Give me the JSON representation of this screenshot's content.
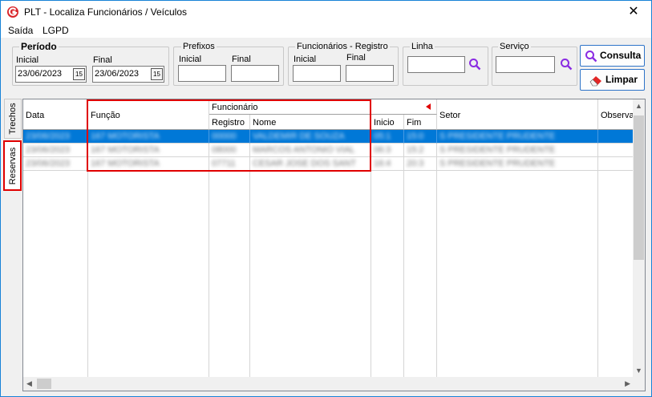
{
  "window": {
    "title": "PLT - Localiza Funcionários / Veículos",
    "close_glyph": "✕"
  },
  "menu": [
    "Saída",
    "LGPD"
  ],
  "periodo": {
    "title": "Período",
    "inicial_label": "Inicial",
    "inicial_value": "23/06/2023",
    "final_label": "Final",
    "final_value": "23/06/2023",
    "cal_glyph": "15"
  },
  "prefixos": {
    "title": "Prefixos",
    "inicial_label": "Inicial",
    "final_label": "Final"
  },
  "funcionarios": {
    "title": "Funcionários - Registro",
    "inicial_label": "Inicial",
    "final_label": "Final"
  },
  "linha": {
    "title": "Linha"
  },
  "servico": {
    "title": "Serviço"
  },
  "buttons": {
    "consulta": "Consulta",
    "limpar": "Limpar"
  },
  "side_tabs": [
    "Trechos",
    "Reservas"
  ],
  "grid": {
    "headers": {
      "data": "Data",
      "funcao": "Função",
      "funcionario": "Funcionário",
      "registro": "Registro",
      "nome": "Nome",
      "inicio": "Inicio",
      "fim": "Fim",
      "setor": "Setor",
      "observacao": "Observa"
    },
    "rows": [
      {
        "data": "23/06/2023",
        "funcao": "167 MOTORISTA",
        "registro": "00000",
        "nome": "VALDEMIR DE SOUZA",
        "inicio": "05:1",
        "fim": "15:0",
        "setor": "S PRESIDENTE PRUDENTE"
      },
      {
        "data": "23/06/2023",
        "funcao": "167 MOTORISTA",
        "registro": "08000",
        "nome": "MARCOS ANTONIO VIAL",
        "inicio": "06:3",
        "fim": "15:2",
        "setor": "S PRESIDENTE PRUDENTE"
      },
      {
        "data": "23/06/2023",
        "funcao": "167 MOTORISTA",
        "registro": "07711",
        "nome": "CESAR JOSE DOS SANT",
        "inicio": "16:4",
        "fim": "20:3",
        "setor": "S PRESIDENTE PRUDENTE"
      }
    ]
  },
  "colors": {
    "selection": "#0078d7",
    "highlight": "#e00000",
    "accent": "#8a2be2"
  }
}
